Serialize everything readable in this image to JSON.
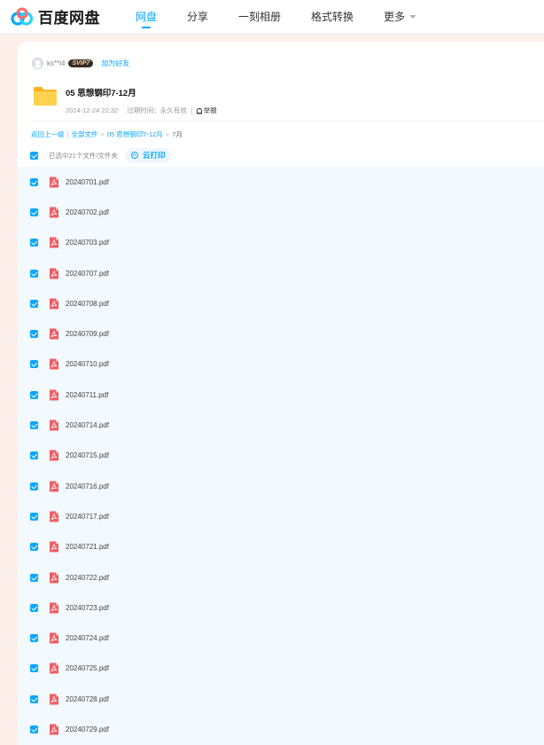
{
  "brand": {
    "name": "百度网盘",
    "colors": {
      "accent": "#06a7ff",
      "pdf": "#f25c62",
      "folder": "#ffc83d"
    }
  },
  "nav": {
    "items": [
      {
        "label": "网盘",
        "active": true
      },
      {
        "label": "分享"
      },
      {
        "label": "一刻相册"
      },
      {
        "label": "格式转换"
      },
      {
        "label": "更多",
        "icon": "chevron-down-icon"
      }
    ]
  },
  "share": {
    "user": "ks**l4",
    "vip_badge": "SVIP7",
    "add_friend": "加为好友",
    "folder_name": "05 思想钢印7-12月",
    "date": "2024-12-24 22:32",
    "expiry": "过期时间：永久有效",
    "report": "举报"
  },
  "breadcrumb": {
    "back": "返回上一级",
    "all_files": "全部文件",
    "parent": "05 思想钢印7-12月",
    "current": "7月"
  },
  "selection": {
    "count_text": "已选中21个文件/文件夹",
    "cloud_print": "云打印"
  },
  "files": [
    {
      "name": "20240701.pdf",
      "checked": true
    },
    {
      "name": "20240702.pdf",
      "checked": true
    },
    {
      "name": "20240703.pdf",
      "checked": true
    },
    {
      "name": "20240707.pdf",
      "checked": true
    },
    {
      "name": "20240708.pdf",
      "checked": true
    },
    {
      "name": "20240709.pdf",
      "checked": true
    },
    {
      "name": "20240710.pdf",
      "checked": true
    },
    {
      "name": "20240711.pdf",
      "checked": true
    },
    {
      "name": "20240714.pdf",
      "checked": true
    },
    {
      "name": "20240715.pdf",
      "checked": true
    },
    {
      "name": "20240716.pdf",
      "checked": true
    },
    {
      "name": "20240717.pdf",
      "checked": true
    },
    {
      "name": "20240721.pdf",
      "checked": true
    },
    {
      "name": "20240722.pdf",
      "checked": true
    },
    {
      "name": "20240723.pdf",
      "checked": true
    },
    {
      "name": "20240724.pdf",
      "checked": true
    },
    {
      "name": "20240725.pdf",
      "checked": true
    },
    {
      "name": "20240728.pdf",
      "checked": true
    },
    {
      "name": "20240729.pdf",
      "checked": true
    }
  ]
}
